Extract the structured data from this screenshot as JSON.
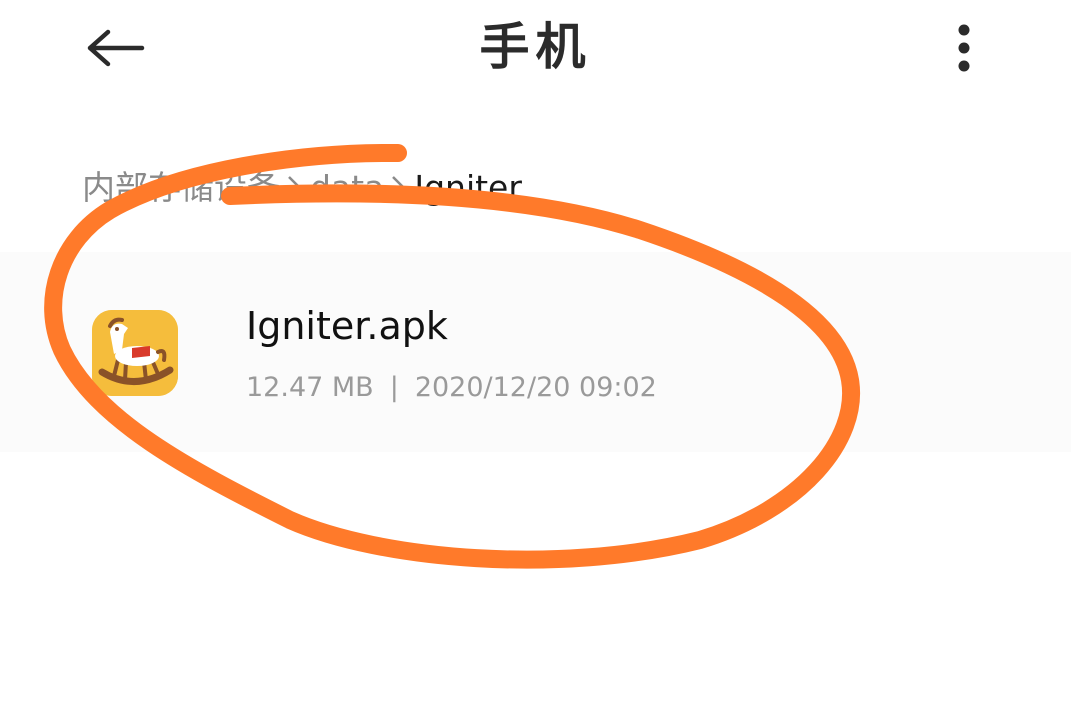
{
  "header": {
    "title": "手机",
    "back_icon": "arrow-left-icon",
    "more_icon": "more-vertical-icon"
  },
  "breadcrumb": {
    "items": [
      "内部存储设备",
      "data",
      "Igniter"
    ],
    "separator_icon": "chevron-right-icon"
  },
  "files": [
    {
      "name": "Igniter.apk",
      "size": "12.47 MB",
      "separator": "|",
      "modified": "2020/12/20 09:02",
      "icon": "rocking-horse-app-icon"
    }
  ],
  "colors": {
    "annotation": "#ff7a2a",
    "icon_bg": "#f5bd3c",
    "text_primary": "#111111",
    "text_secondary": "#9a9a9a"
  }
}
